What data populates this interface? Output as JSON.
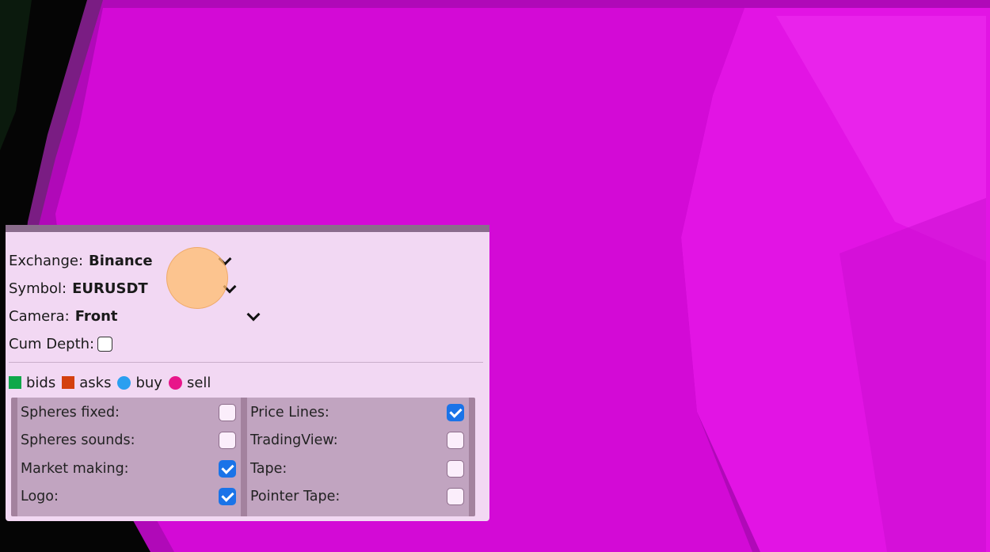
{
  "panel": {
    "exchange": {
      "label": "Exchange:",
      "value": "Binance"
    },
    "symbol": {
      "label": "Symbol:",
      "value": "EURUSDT"
    },
    "camera": {
      "label": "Camera:",
      "value": "Front"
    },
    "cum_depth": {
      "label": "Cum Depth:",
      "checked": false
    },
    "legend": [
      {
        "label": "bids",
        "color": "#0fa84a",
        "shape": "square"
      },
      {
        "label": "asks",
        "color": "#d4400e",
        "shape": "square"
      },
      {
        "label": "buy",
        "color": "#2b9ff0",
        "shape": "circle"
      },
      {
        "label": "sell",
        "color": "#e8168a",
        "shape": "circle"
      }
    ],
    "options_left": [
      {
        "label": "Spheres fixed:",
        "checked": false
      },
      {
        "label": "Spheres sounds:",
        "checked": false
      },
      {
        "label": "Market making:",
        "checked": true
      },
      {
        "label": "Logo:",
        "checked": true
      }
    ],
    "options_right": [
      {
        "label": "Price Lines:",
        "checked": true
      },
      {
        "label": "TradingView:",
        "checked": false
      },
      {
        "label": "Tape:",
        "checked": false
      },
      {
        "label": "Pointer Tape:",
        "checked": false
      }
    ]
  },
  "colors": {
    "scene_primary": "#d40ad6",
    "scene_dark": "#050505",
    "panel_bg": "#f2d8f3",
    "checkbox_checked": "#1a73e8"
  }
}
